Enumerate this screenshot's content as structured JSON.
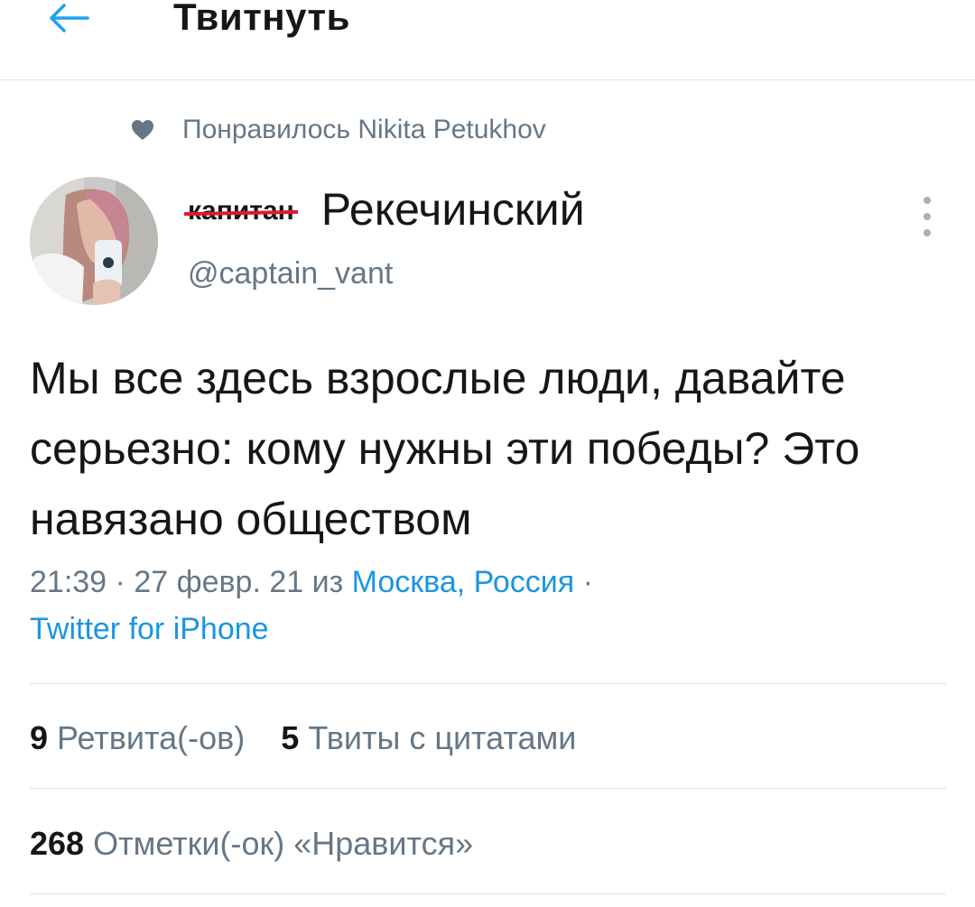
{
  "header": {
    "title": "Твитнуть",
    "back_icon": "arrow-left-icon",
    "accent": "#1da1f2"
  },
  "social_context": {
    "icon": "heart-icon",
    "text": "Понравилось Nikita Petukhov"
  },
  "author": {
    "name_struck": "капитан",
    "name": "Рекечинский",
    "handle": "@captain_vant",
    "avatar": "user-avatar-photo"
  },
  "tweet": {
    "text": "Мы все здесь взрослые люди, давайте серьезно: кому нужны эти победы? Это навязано обществом",
    "time": "21:39",
    "date": "27 февр. 21",
    "from_word": "из",
    "location": "Москва, Россия",
    "separator": "·",
    "client": "Twitter for iPhone"
  },
  "stats": {
    "retweets_count": "9",
    "retweets_label": "Ретвита(-ов)",
    "quotes_count": "5",
    "quotes_label": "Твиты с цитатами",
    "likes_count": "268",
    "likes_label": "Отметки(-ок) «Нравится»"
  },
  "colors": {
    "link": "#1b95e0",
    "secondary": "#657786",
    "strike": "#e0182d"
  }
}
